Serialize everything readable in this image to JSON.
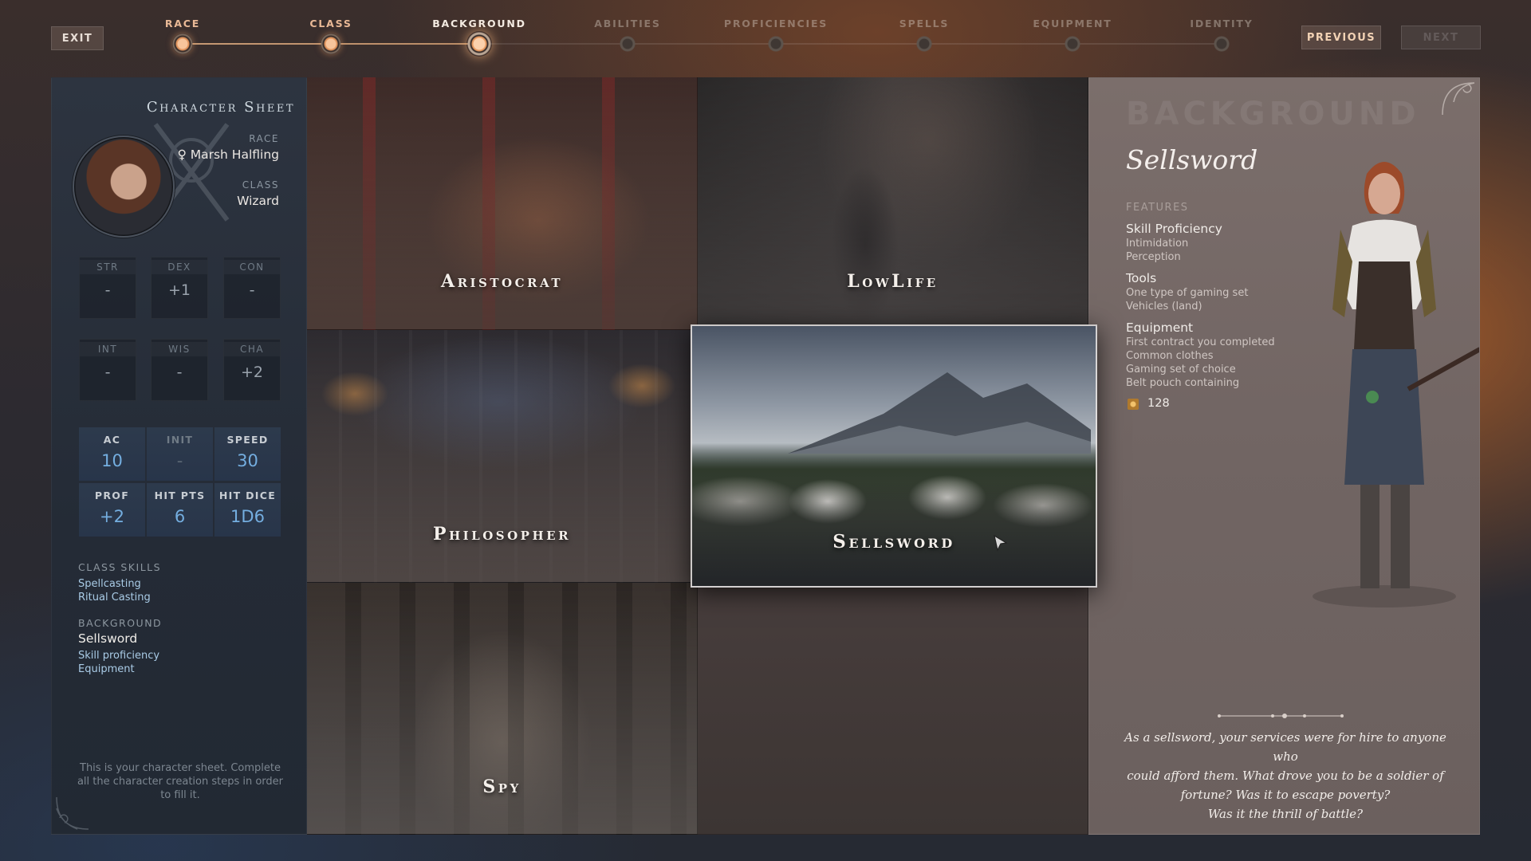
{
  "topbar": {
    "exit_label": "EXIT",
    "previous_label": "PREVIOUS",
    "next_label": "NEXT",
    "steps": [
      {
        "label": "RACE",
        "state": "done"
      },
      {
        "label": "CLASS",
        "state": "done"
      },
      {
        "label": "BACKGROUND",
        "state": "current"
      },
      {
        "label": "ABILITIES",
        "state": "todo"
      },
      {
        "label": "PROFICIENCIES",
        "state": "todo"
      },
      {
        "label": "SPELLS",
        "state": "todo"
      },
      {
        "label": "EQUIPMENT",
        "state": "todo"
      },
      {
        "label": "IDENTITY",
        "state": "todo"
      }
    ]
  },
  "sheet": {
    "title": "Character Sheet",
    "race_label": "RACE",
    "race_gender_symbol": "♀",
    "race_value": "Marsh Halfling",
    "class_label": "CLASS",
    "class_value": "Wizard",
    "abilities": [
      {
        "name": "STR",
        "value": "-"
      },
      {
        "name": "DEX",
        "value": "+1"
      },
      {
        "name": "CON",
        "value": "-"
      },
      {
        "name": "INT",
        "value": "-"
      },
      {
        "name": "WIS",
        "value": "-"
      },
      {
        "name": "CHA",
        "value": "+2"
      }
    ],
    "stats": [
      {
        "name": "AC",
        "value": "10"
      },
      {
        "name": "INIT",
        "value": "-"
      },
      {
        "name": "SPEED",
        "value": "30"
      },
      {
        "name": "PROF",
        "value": "+2"
      },
      {
        "name": "HIT PTS",
        "value": "6"
      },
      {
        "name": "HIT DICE",
        "value": "1D6"
      }
    ],
    "class_skills_label": "CLASS SKILLS",
    "class_skills": [
      "Spellcasting",
      "Ritual Casting"
    ],
    "background_label": "BACKGROUND",
    "background_value": "Sellsword",
    "background_items": [
      "Skill proficiency",
      "Equipment"
    ],
    "note": "This is your character sheet. Complete all the character creation steps in order to fill it."
  },
  "grid": {
    "tiles": [
      {
        "title": "Aristocrat"
      },
      {
        "title": "LowLife"
      },
      {
        "title": "Philosopher"
      },
      {
        "title": "Sellsword",
        "selected": true
      },
      {
        "title": "Spy"
      }
    ]
  },
  "detail": {
    "heading": "BACKGROUND",
    "name": "Sellsword",
    "features_label": "FEATURES",
    "skill_title": "Skill Proficiency",
    "skill_items": [
      "Intimidation",
      "Perception"
    ],
    "tools_title": "Tools",
    "tools_items": [
      "One type of gaming set",
      "Vehicles (land)"
    ],
    "equipment_title": "Equipment",
    "equipment_items": [
      "First contract you completed",
      "Common clothes",
      "Gaming set of choice",
      "Belt pouch containing"
    ],
    "coins": "128",
    "description_lines": [
      "As a sellsword, your services were for hire to anyone who",
      "could afford them. What drove you to be a soldier of",
      "fortune? Was it to escape poverty?",
      "Was it the thrill of battle?"
    ]
  },
  "colors": {
    "accent": "#e9b996",
    "stat_value": "#74aee0",
    "skill_text": "#a9cbe6"
  }
}
